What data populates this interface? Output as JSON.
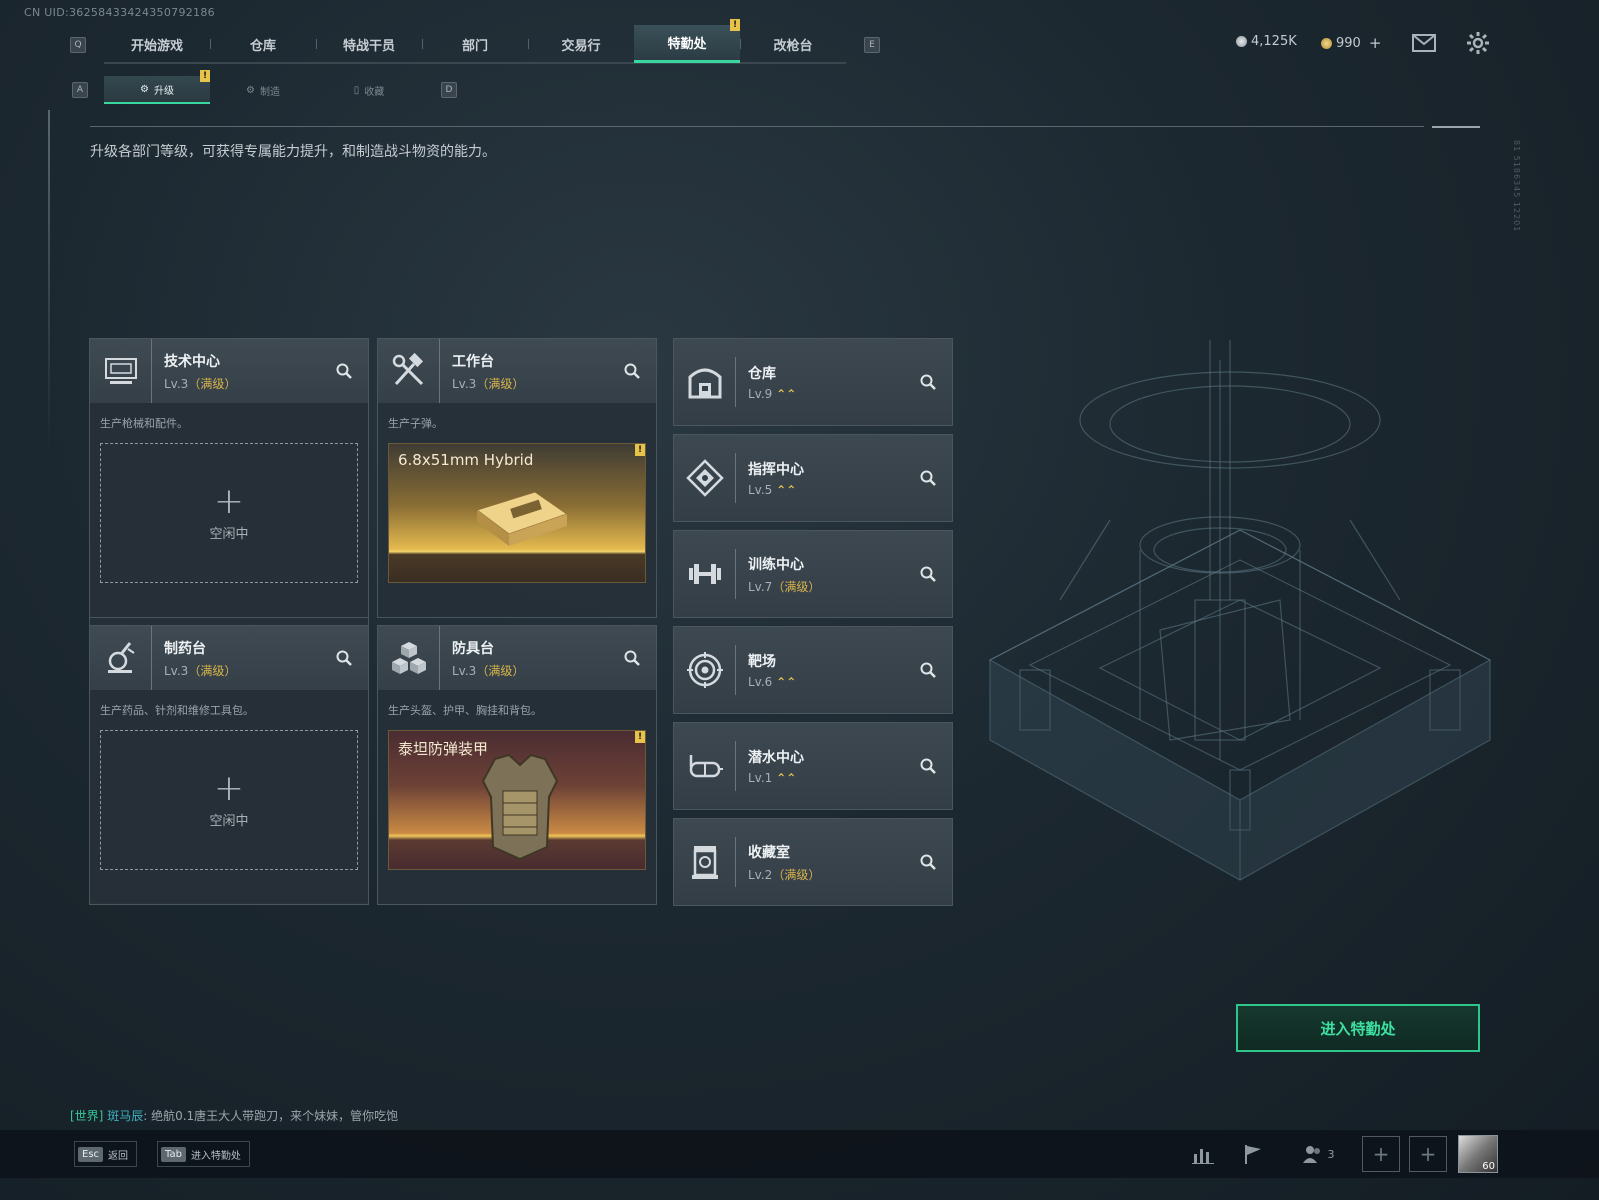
{
  "uid_text": "CN UID:36258433424350792186",
  "nav": {
    "left_key": "Q",
    "right_key": "E",
    "tabs": [
      {
        "label": "开始游戏"
      },
      {
        "label": "仓库"
      },
      {
        "label": "特战干员"
      },
      {
        "label": "部门"
      },
      {
        "label": "交易行"
      },
      {
        "label": "特勤处",
        "active": true,
        "badge": "!"
      },
      {
        "label": "改枪台"
      }
    ]
  },
  "currency": {
    "silver": "4,125K",
    "gold": "990"
  },
  "subnav": {
    "left_key": "A",
    "right_key": "D",
    "tabs": [
      {
        "label": "升级",
        "active": true,
        "badge": "!"
      },
      {
        "label": "制造"
      },
      {
        "label": "收藏"
      }
    ]
  },
  "description": "升级各部门等级，可获得专属能力提升，和制造战斗物资的能力。",
  "main_cards": [
    {
      "icon": "computer-icon",
      "name": "技术中心",
      "level": "Lv.3",
      "status": "（满级）",
      "desc": "生产枪械和配件。",
      "slot": {
        "type": "idle",
        "label": "空闲中"
      }
    },
    {
      "icon": "tools-icon",
      "name": "工作台",
      "level": "Lv.3",
      "status": "（满级）",
      "desc": "生产子弹。",
      "slot": {
        "type": "product",
        "label": "6.8x51mm Hybrid",
        "badge": "!"
      }
    },
    {
      "icon": "flask-icon",
      "name": "制药台",
      "level": "Lv.3",
      "status": "（满级）",
      "desc": "生产药品、针剂和维修工具包。",
      "slot": {
        "type": "idle",
        "label": "空闲中"
      }
    },
    {
      "icon": "armor-blocks-icon",
      "name": "防具台",
      "level": "Lv.3",
      "status": "（满级）",
      "desc": "生产头盔、护甲、胸挂和背包。",
      "slot": {
        "type": "product",
        "label": "泰坦防弹装甲",
        "badge": "!"
      }
    }
  ],
  "side_cards": [
    {
      "icon": "warehouse-icon",
      "name": "仓库",
      "level": "Lv.9",
      "status": "⌃⌃"
    },
    {
      "icon": "command-icon",
      "name": "指挥中心",
      "level": "Lv.5",
      "status": "⌃⌃"
    },
    {
      "icon": "dumbbell-icon",
      "name": "训练中心",
      "level": "Lv.7",
      "status": "（满级）"
    },
    {
      "icon": "target-icon",
      "name": "靶场",
      "level": "Lv.6",
      "status": "⌃⌃"
    },
    {
      "icon": "goggles-icon",
      "name": "潜水中心",
      "level": "Lv.1",
      "status": "⌃⌃"
    },
    {
      "icon": "collection-icon",
      "name": "收藏室",
      "level": "Lv.2",
      "status": "（满级）"
    }
  ],
  "enter_button": "进入特勤处",
  "chat": {
    "channel": "[世界]",
    "user": "斑马辰",
    "message": "绝航0.1唐王大人带跑刀，来个妹妹，管你吃饱"
  },
  "hints": [
    {
      "key": "Esc",
      "label": "返回"
    },
    {
      "key": "Tab",
      "label": "进入特勤处"
    }
  ],
  "bottom": {
    "friends_count": "3",
    "avatar_level": "60"
  },
  "colors": {
    "accent": "#3ad6a0",
    "badge": "#e7c34a",
    "max_level": "#d8b44a"
  }
}
